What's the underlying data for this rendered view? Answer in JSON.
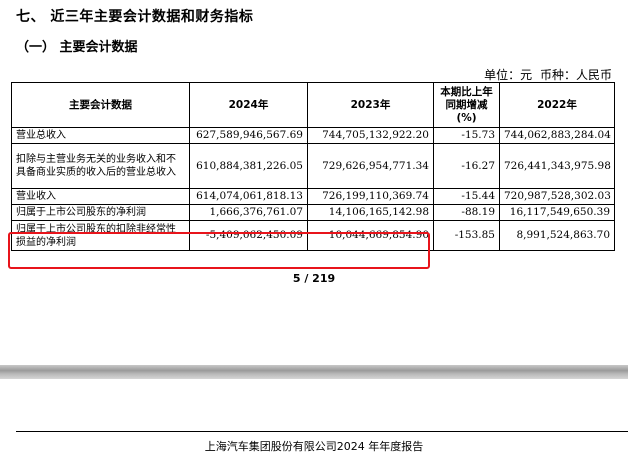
{
  "section_title": "七、 近三年主要会计数据和财务指标",
  "subsection_title": "（一） 主要会计数据",
  "unit_line": "单位：元  币种：人民币",
  "table": {
    "headers": [
      "主要会计数据",
      "2024年",
      "2023年",
      "本期比上年同期增减(%)",
      "2022年"
    ],
    "rows": [
      {
        "label": "营业总收入",
        "values": [
          "627,589,946,567.69",
          "744,705,132,922.20",
          "-15.73",
          "744,062,883,284.04"
        ]
      },
      {
        "label": "扣除与主营业务无关的业务收入和不具备商业实质的收入后的营业总收入",
        "values": [
          "610,884,381,226.05",
          "729,626,954,771.34",
          "-16.27",
          "726,441,343,975.98"
        ]
      },
      {
        "label": "营业收入",
        "values": [
          "614,074,061,818.13",
          "726,199,110,369.74",
          "-15.44",
          "720,987,528,302.03"
        ]
      },
      {
        "label": "归属于上市公司股东的净利润",
        "values": [
          "1,666,376,761.07",
          "14,106,165,142.98",
          "-88.19",
          "16,117,549,650.39"
        ]
      },
      {
        "label": "归属于上市公司股东的扣除非经常性损益的净利润",
        "values": [
          "-5,409,062,450.09",
          "10,044,669,854.90",
          "-153.85",
          "8,991,524,863.70"
        ]
      }
    ]
  },
  "page_number": "5 / 219",
  "footer": "上海汽车集团股份有限公司2024 年年度报告",
  "colors": {
    "highlight": "#e8141b"
  }
}
